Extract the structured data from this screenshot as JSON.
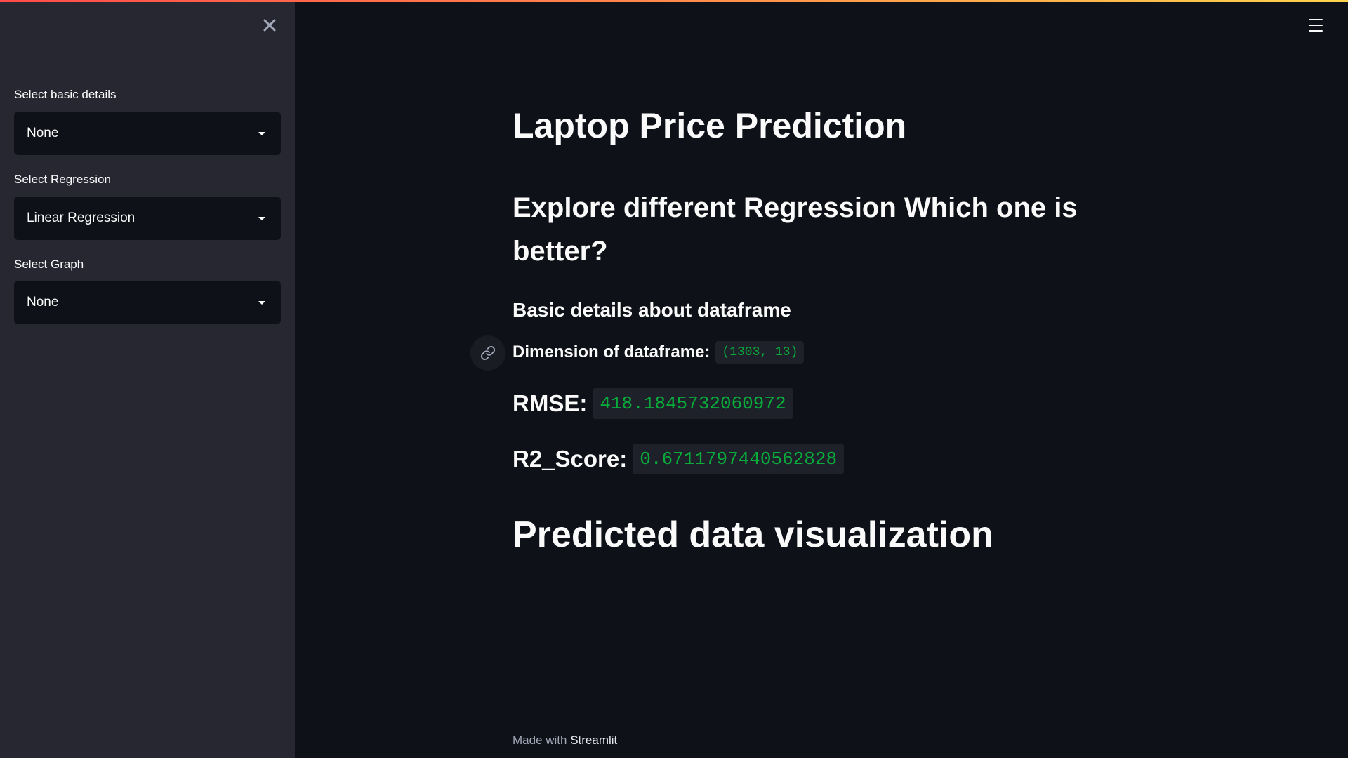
{
  "sidebar": {
    "basic_details": {
      "label": "Select basic details",
      "value": "None"
    },
    "regression": {
      "label": "Select Regression",
      "value": "Linear Regression"
    },
    "graph": {
      "label": "Select Graph",
      "value": "None"
    }
  },
  "main": {
    "title": "Laptop Price Prediction",
    "subtitle": "Explore different Regression Which one is better?",
    "section_heading": "Basic details about dataframe",
    "dimension": {
      "label": "Dimension of dataframe:",
      "value": "(1303, 13)"
    },
    "rmse": {
      "label": "RMSE:",
      "value": "418.1845732060972"
    },
    "r2": {
      "label": "R2_Score:",
      "value": "0.6711797440562828"
    },
    "viz_heading": "Predicted data visualization"
  },
  "footer": {
    "prefix": "Made with",
    "brand": "Streamlit"
  },
  "icons": {
    "close": "close-icon",
    "menu": "hamburger-menu-icon",
    "link": "link-icon",
    "caret": "caret-down-icon"
  },
  "colors": {
    "accent_start": "#ff4b4b",
    "accent_end": "#ffd44b",
    "code_text": "#09ab3b",
    "background": "#0e1117",
    "sidebar": "#262730"
  }
}
